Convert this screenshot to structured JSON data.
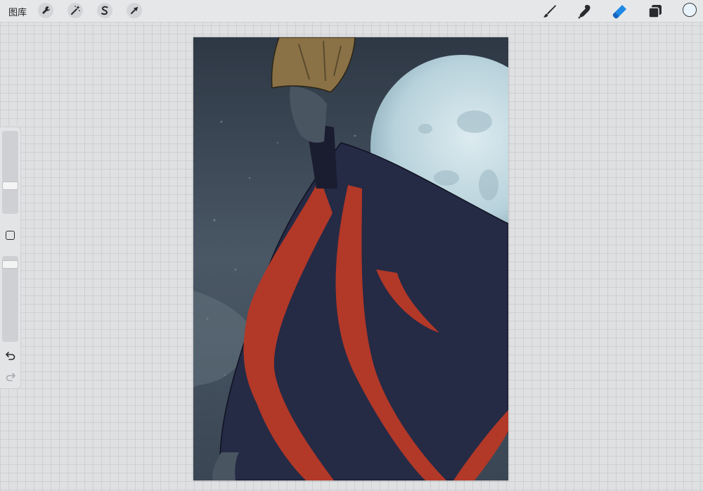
{
  "toolbar": {
    "gallery_label": "图库",
    "left_tools": [
      {
        "name": "actions",
        "icon": "wrench-icon"
      },
      {
        "name": "adjustments",
        "icon": "magic-wand-icon"
      },
      {
        "name": "selection",
        "icon": "selection-s-icon"
      },
      {
        "name": "transform",
        "icon": "transform-arrow-icon"
      }
    ],
    "right_tools": [
      {
        "name": "brush",
        "icon": "brush-icon",
        "active": false
      },
      {
        "name": "smudge",
        "icon": "smudge-icon",
        "active": false
      },
      {
        "name": "eraser",
        "icon": "eraser-icon",
        "active": true
      },
      {
        "name": "layers",
        "icon": "layers-icon",
        "active": false
      }
    ],
    "current_color": "#e8f3fb",
    "accent": "#1e88e5"
  },
  "sidebar": {
    "brush_size_level": 0.32,
    "opacity_level": 0.95,
    "undo_icon": "undo-icon",
    "redo_icon": "redo-icon",
    "modify_icon": "square-icon"
  },
  "canvas": {
    "sky_color": "#3e4a58",
    "moon_color": "#c9dfe6",
    "robe_color": "#252a45",
    "trim_color": "#b23828",
    "hat_color": "#8a7246",
    "skin_color": "#4a5562"
  }
}
